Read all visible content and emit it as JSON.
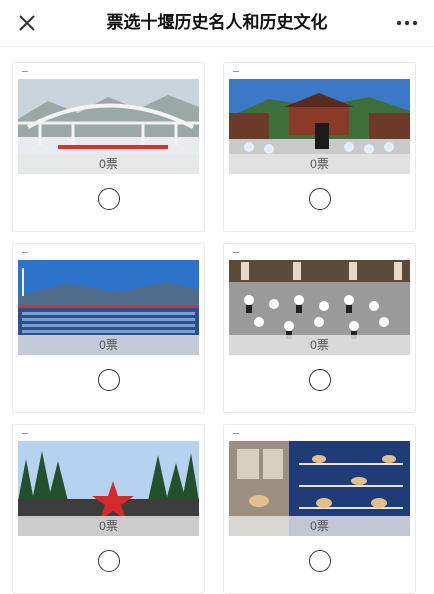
{
  "header": {
    "title": "票选十堰历史名人和历史文化",
    "close_icon": "close-icon",
    "more_icon": "more-dots-icon"
  },
  "cards": [
    {
      "votes": "0票",
      "image": "bridge-over-river-photo"
    },
    {
      "votes": "0票",
      "image": "taichi-temple-photo"
    },
    {
      "votes": "0票",
      "image": "seated-crowd-stadium-photo"
    },
    {
      "votes": "0票",
      "image": "students-ceremony-photo"
    },
    {
      "votes": "0票",
      "image": "red-star-monument-photo"
    },
    {
      "votes": "0票",
      "image": "museum-exhibit-photo"
    }
  ],
  "colors": {
    "background": "#ffffff",
    "card_border": "#e9e9e9",
    "vote_overlay": "#e6e6e6"
  }
}
